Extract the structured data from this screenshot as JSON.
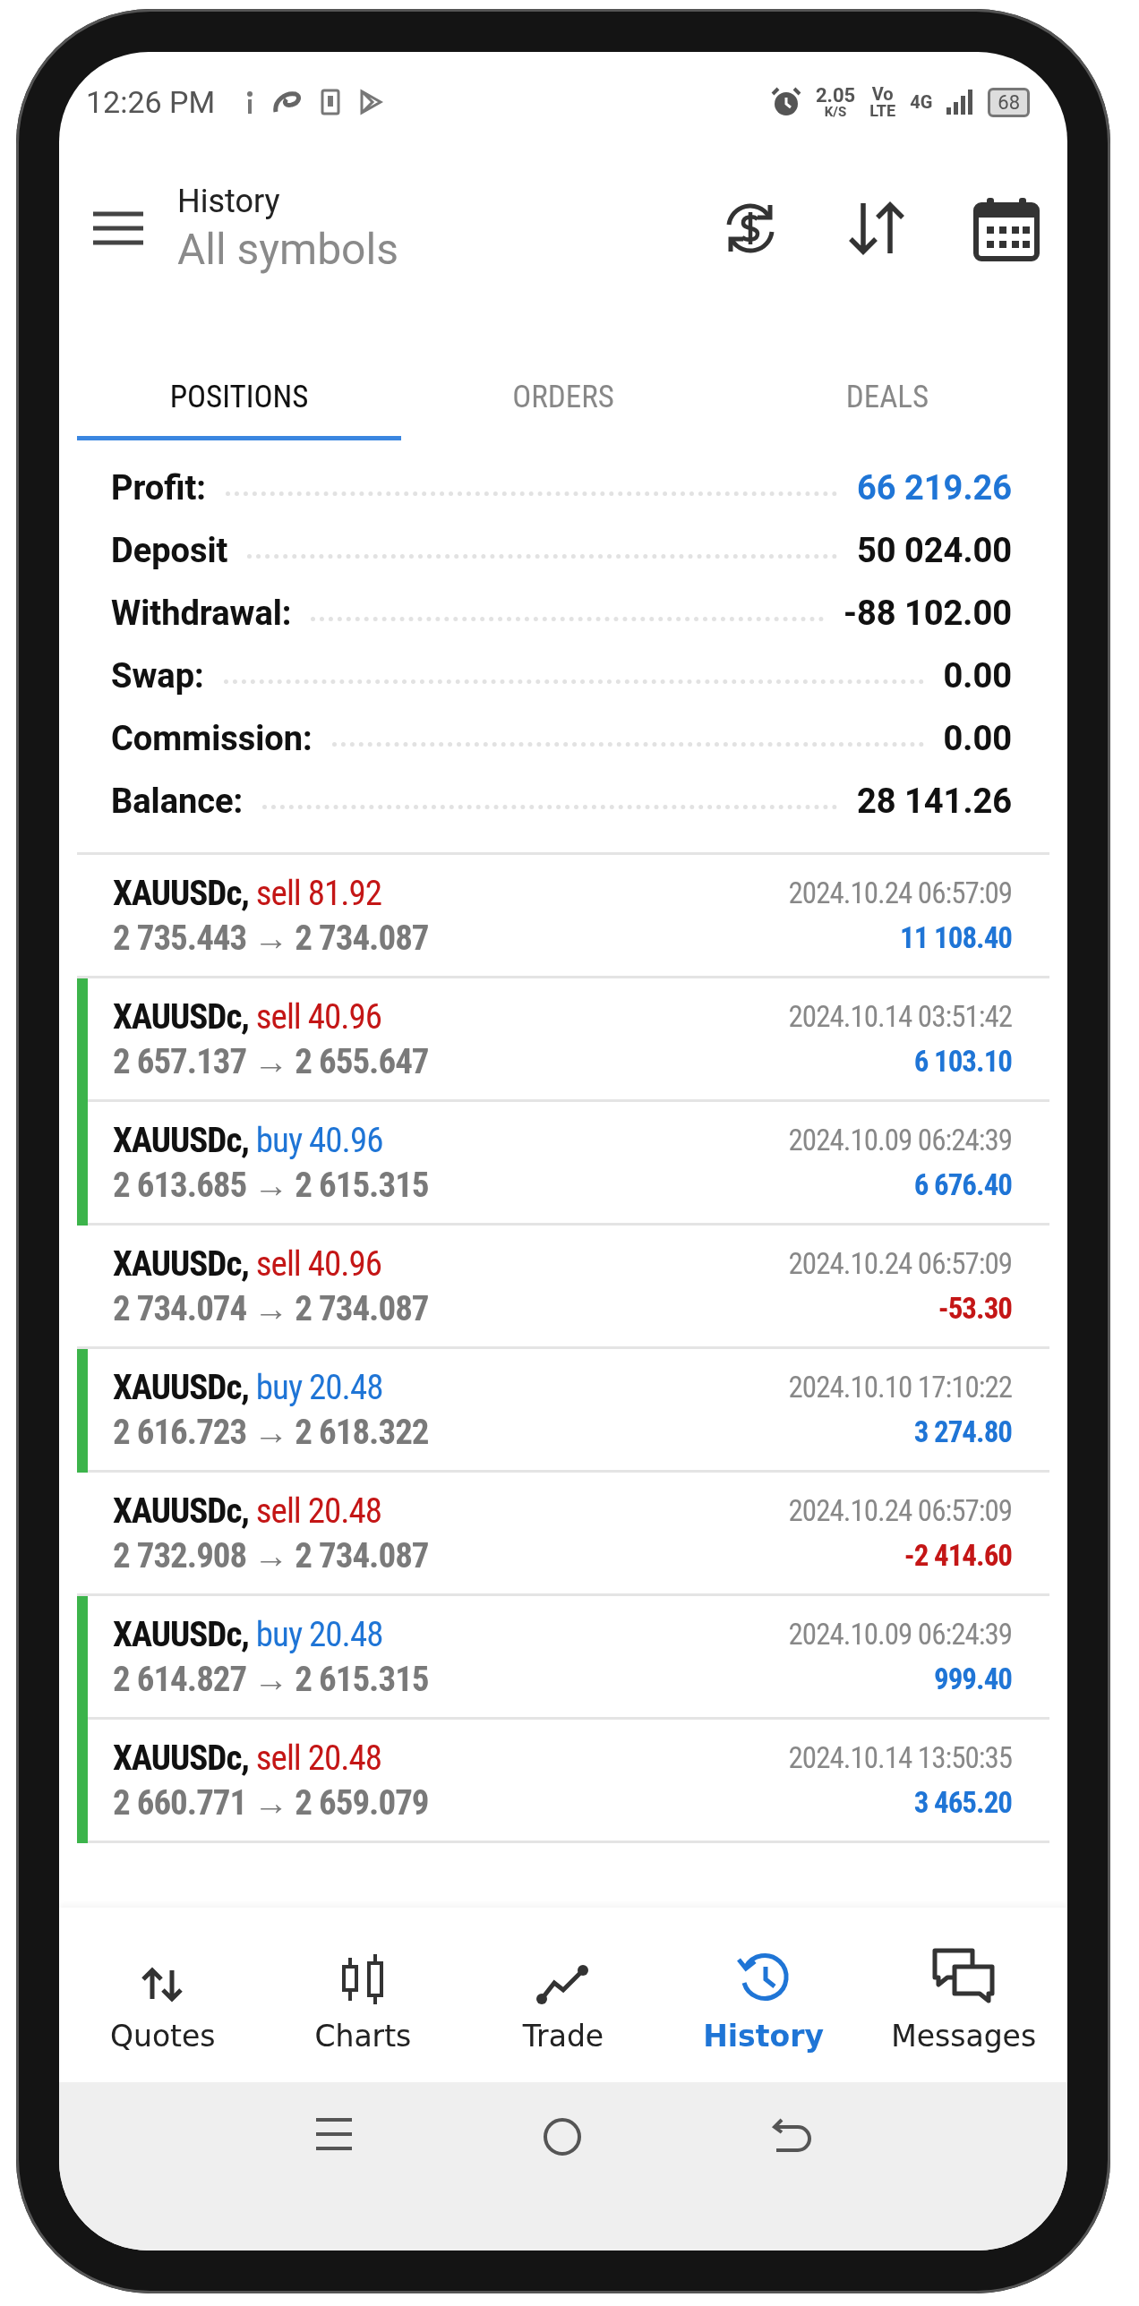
{
  "status_bar": {
    "time": "12:26 PM",
    "speed": "2.05",
    "speed_unit": "K/S",
    "volte_top": "Vo",
    "volte_bottom": "LTE",
    "network": "4G",
    "battery": "68"
  },
  "header": {
    "title": "History",
    "subtitle": "All symbols"
  },
  "tabs": [
    {
      "label": "POSITIONS",
      "selected": true
    },
    {
      "label": "ORDERS",
      "selected": false
    },
    {
      "label": "DEALS",
      "selected": false
    }
  ],
  "summary": [
    {
      "label": "Profit:",
      "value": "66 219.26",
      "highlight": true
    },
    {
      "label": "Deposit",
      "value": "50 024.00",
      "highlight": false
    },
    {
      "label": "Withdrawal:",
      "value": "-88 102.00",
      "highlight": false
    },
    {
      "label": "Swap:",
      "value": "0.00",
      "highlight": false
    },
    {
      "label": "Commission:",
      "value": "0.00",
      "highlight": false
    },
    {
      "label": "Balance:",
      "value": "28 141.26",
      "highlight": false
    }
  ],
  "positions": [
    {
      "symbol": "XAUUSDc,",
      "side": "sell 81.92",
      "kind": "sell",
      "prices": "2 735.443 → 2 734.087",
      "time": "2024.10.24 06:57:09",
      "profit": "11 108.40",
      "loss": false,
      "marked": false
    },
    {
      "symbol": "XAUUSDc,",
      "side": "sell 40.96",
      "kind": "sell",
      "prices": "2 657.137 → 2 655.647",
      "time": "2024.10.14 03:51:42",
      "profit": "6 103.10",
      "loss": false,
      "marked": true
    },
    {
      "symbol": "XAUUSDc,",
      "side": "buy 40.96",
      "kind": "buy",
      "prices": "2 613.685 → 2 615.315",
      "time": "2024.10.09 06:24:39",
      "profit": "6 676.40",
      "loss": false,
      "marked": true
    },
    {
      "symbol": "XAUUSDc,",
      "side": "sell 40.96",
      "kind": "sell",
      "prices": "2 734.074 → 2 734.087",
      "time": "2024.10.24 06:57:09",
      "profit": "-53.30",
      "loss": true,
      "marked": false
    },
    {
      "symbol": "XAUUSDc,",
      "side": "buy 20.48",
      "kind": "buy",
      "prices": "2 616.723 → 2 618.322",
      "time": "2024.10.10 17:10:22",
      "profit": "3 274.80",
      "loss": false,
      "marked": true
    },
    {
      "symbol": "XAUUSDc,",
      "side": "sell 20.48",
      "kind": "sell",
      "prices": "2 732.908 → 2 734.087",
      "time": "2024.10.24 06:57:09",
      "profit": "-2 414.60",
      "loss": true,
      "marked": false
    },
    {
      "symbol": "XAUUSDc,",
      "side": "buy 20.48",
      "kind": "buy",
      "prices": "2 614.827 → 2 615.315",
      "time": "2024.10.09 06:24:39",
      "profit": "999.40",
      "loss": false,
      "marked": true
    },
    {
      "symbol": "XAUUSDc,",
      "side": "sell 20.48",
      "kind": "sell",
      "prices": "2 660.771 → 2 659.079",
      "time": "2024.10.14 13:50:35",
      "profit": "3 465.20",
      "loss": false,
      "marked": true
    }
  ],
  "bottom_nav": [
    {
      "label": "Quotes",
      "kind": "quotes",
      "selected": false
    },
    {
      "label": "Charts",
      "kind": "charts",
      "selected": false
    },
    {
      "label": "Trade",
      "kind": "trade",
      "selected": false
    },
    {
      "label": "History",
      "kind": "history",
      "selected": true
    },
    {
      "label": "Messages",
      "kind": "messages",
      "selected": false
    }
  ]
}
